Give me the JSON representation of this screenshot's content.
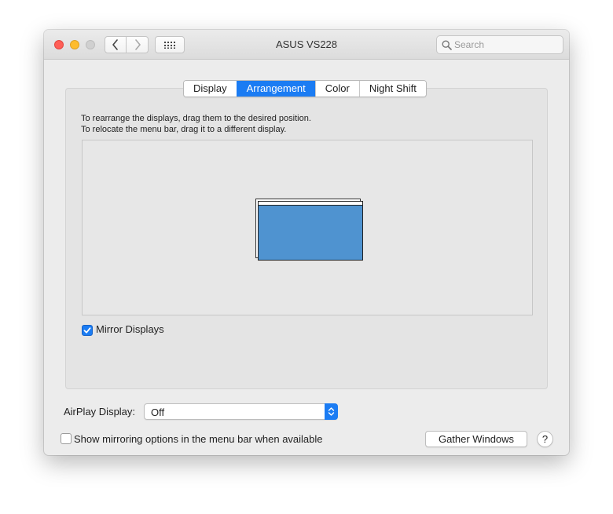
{
  "window": {
    "title": "ASUS VS228"
  },
  "search": {
    "placeholder": "Search"
  },
  "tabs": [
    {
      "label": "Display",
      "active": false
    },
    {
      "label": "Arrangement",
      "active": true
    },
    {
      "label": "Color",
      "active": false
    },
    {
      "label": "Night Shift",
      "active": false
    }
  ],
  "instructions": {
    "line1": "To rearrange the displays, drag them to the desired position.",
    "line2": "To relocate the menu bar, drag it to a different display."
  },
  "mirror": {
    "label": "Mirror Displays",
    "checked": true
  },
  "airplay": {
    "label": "AirPlay Display:",
    "value": "Off"
  },
  "show_mirroring": {
    "label": "Show mirroring options in the menu bar when available",
    "checked": false
  },
  "buttons": {
    "gather": "Gather Windows",
    "help": "?"
  },
  "colors": {
    "accent": "#1b7cf3",
    "display_fill": "#4f93d0",
    "close": "#ff5f57",
    "minimize": "#febc2e",
    "zoom_disabled": "#d0d0d0"
  },
  "icons": {
    "back": "chevron-left-icon",
    "forward": "chevron-right-icon",
    "grid": "grid-icon",
    "search": "search-icon",
    "checkmark": "checkmark-icon",
    "popup_arrows": "up-down-arrows-icon"
  }
}
